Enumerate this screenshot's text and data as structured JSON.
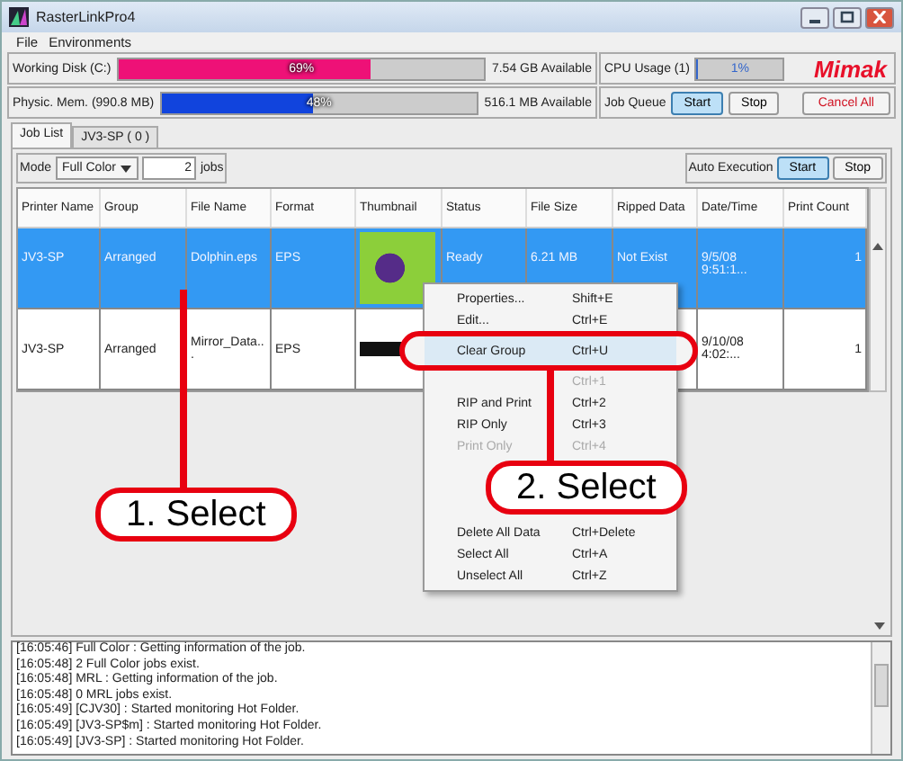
{
  "window": {
    "title": "RasterLinkPro4"
  },
  "menu": [
    "File",
    "Environments"
  ],
  "meters": [
    {
      "label": "Working Disk (C:)",
      "level": 0.69,
      "reading": "69%",
      "color": "#ee1177",
      "available": "7.54 GB Available"
    },
    {
      "label": "Physic. Mem. (990.8 MB)",
      "level": 0.48,
      "reading": "48%",
      "color": "#1144dd",
      "available": "516.1 MB Available"
    }
  ],
  "cpu": {
    "label": "CPU Usage (1)",
    "level": 0.01,
    "reading": "1%"
  },
  "logo": "Mimak",
  "job_queue": {
    "label": "Job Queue",
    "buttons": [
      {
        "label": "Start",
        "selected": true
      },
      {
        "label": "Stop",
        "selected": false
      }
    ]
  },
  "cancel_all": "Cancel All",
  "tabs": [
    {
      "label": "Job List",
      "selected": true
    },
    {
      "label": "JV3-SP ( 0 )",
      "selected": false
    }
  ],
  "mode": {
    "label": "Mode",
    "value": "Full Color",
    "count": "2",
    "unit": "jobs"
  },
  "auto_execution": {
    "label": "Auto Execution",
    "buttons": [
      {
        "label": "Start",
        "selected": true
      },
      {
        "label": "Stop",
        "selected": false
      }
    ]
  },
  "table": {
    "columns": [
      "Printer Name",
      "Group",
      "File Name",
      "Format",
      "Thumbnail",
      "Status",
      "File Size",
      "Ripped Data",
      "Date/Time",
      "Print Count"
    ],
    "rows": [
      {
        "selected": true,
        "cells": [
          "JV3-SP",
          "Arranged",
          "Dolphin.eps",
          "EPS",
          "",
          "Ready",
          "6.21 MB",
          "Not Exist",
          "9/5/08 9:51:1...",
          "1"
        ]
      },
      {
        "selected": false,
        "cells": [
          "JV3-SP",
          "Arranged",
          "Mirror_Data...",
          "EPS",
          "",
          "",
          "",
          "",
          "9/10/08 4:02:...",
          "1"
        ]
      }
    ]
  },
  "context_menu": [
    {
      "label": "Properties...",
      "shortcut": "Shift+E",
      "disabled": false,
      "highlighted": false
    },
    {
      "label": "Edit...",
      "shortcut": "Ctrl+E",
      "disabled": false,
      "highlighted": false
    },
    {
      "label": "Clear Group",
      "shortcut": "Ctrl+U",
      "disabled": false,
      "highlighted": true
    },
    {
      "shortcut": "Ctrl+1",
      "disabled": true,
      "highlighted": false
    },
    {
      "label": "RIP and Print",
      "shortcut": "Ctrl+2",
      "disabled": false,
      "highlighted": false
    },
    {
      "label": "RIP Only",
      "shortcut": "Ctrl+3",
      "disabled": false,
      "highlighted": false
    },
    {
      "label": "Print Only",
      "shortcut": "Ctrl+4",
      "disabled": true,
      "highlighted": false
    },
    {
      "label": "Delete All Data",
      "shortcut": "Ctrl+Delete",
      "disabled": false,
      "highlighted": false
    },
    {
      "label": "Select All",
      "shortcut": "Ctrl+A",
      "disabled": false,
      "highlighted": false
    },
    {
      "label": "Unselect All",
      "shortcut": "Ctrl+Z",
      "disabled": false,
      "highlighted": false
    }
  ],
  "log": [
    "[16:05:46] Full Color : Getting information of the job.",
    "[16:05:48] 2 Full Color jobs exist.",
    "[16:05:48] MRL : Getting information of the job.",
    "[16:05:48] 0 MRL jobs exist.",
    "[16:05:49] [CJV30] : Started monitoring Hot Folder.",
    "[16:05:49] [JV3-SP$m] : Started monitoring Hot Folder.",
    "[16:05:49] [JV3-SP] : Started monitoring Hot Folder."
  ],
  "callouts": [
    "1. Select",
    "2. Select"
  ]
}
